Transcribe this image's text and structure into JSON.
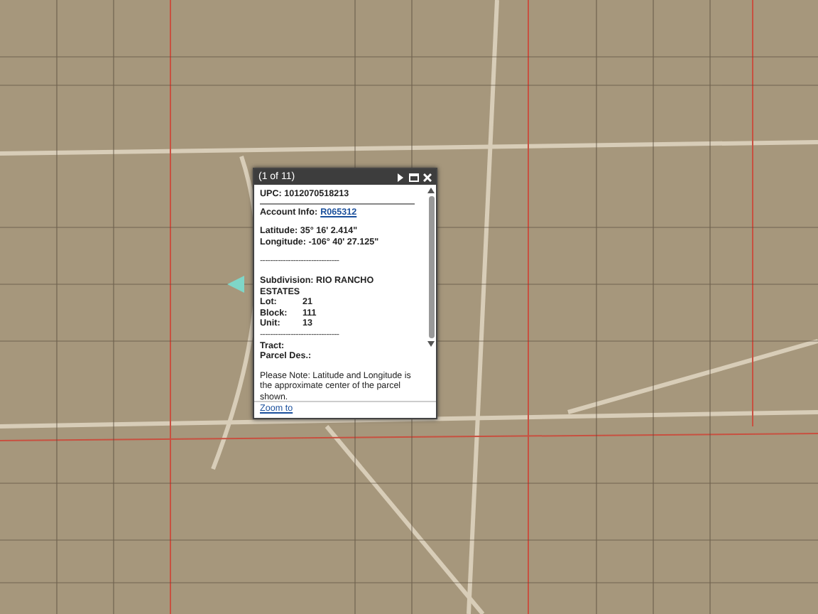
{
  "popup": {
    "title": "(1 of 11)",
    "upc": "UPC: 1012070518213",
    "account_label": "Account Info:",
    "account_link": "R065312",
    "latitude": "Latitude: 35° 16' 2.414\"",
    "longitude": "Longitude: -106° 40' 27.125\"",
    "separator": "-------------------------------",
    "subdivision": "Subdivision: RIO RANCHO ESTATES",
    "fields": [
      {
        "label": "Lot:",
        "value": "21"
      },
      {
        "label": "Block:",
        "value": "111"
      },
      {
        "label": "Unit:",
        "value": "13"
      }
    ],
    "separator_2": "-------------------------------",
    "tract": "Tract:",
    "parcel": "Parcel Des.:",
    "note": "Please Note: Latitude and Longitude is the approximate center of the parcel shown.",
    "zoom_link": "Zoom to"
  }
}
